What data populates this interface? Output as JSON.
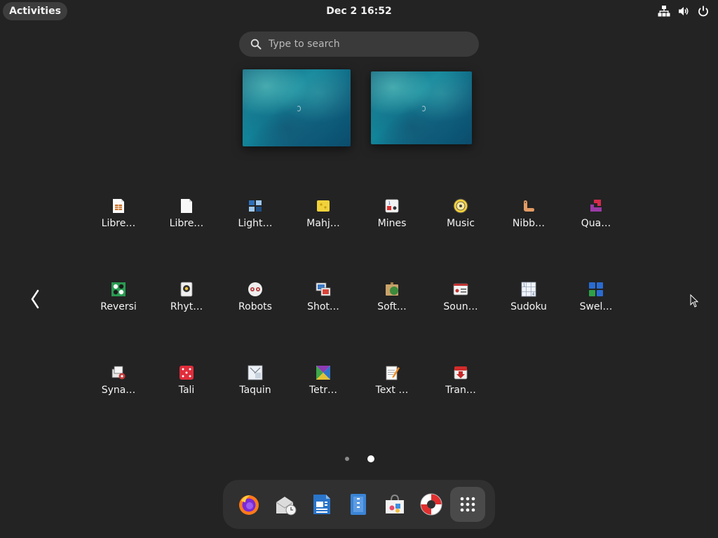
{
  "topbar": {
    "activities_label": "Activities",
    "clock": "Dec 2  16:52",
    "tray_icons": [
      "network-icon",
      "volume-icon",
      "power-icon"
    ]
  },
  "search": {
    "placeholder": "Type to search"
  },
  "workspaces": [
    "workspace-1",
    "workspace-2"
  ],
  "apps": [
    {
      "label": "Libre…",
      "icon": "libreoffice-calc-icon"
    },
    {
      "label": "Libre…",
      "icon": "libreoffice-document-icon"
    },
    {
      "label": "Light…",
      "icon": "lightsoff-icon"
    },
    {
      "label": "Mahj…",
      "icon": "mahjongg-icon"
    },
    {
      "label": "Mines",
      "icon": "mines-icon"
    },
    {
      "label": "Music",
      "icon": "music-icon"
    },
    {
      "label": "Nibb…",
      "icon": "nibbles-icon"
    },
    {
      "label": "Qua…",
      "icon": "quadrapassel-icon"
    },
    {
      "label": "Reversi",
      "icon": "reversi-icon"
    },
    {
      "label": "Rhyt…",
      "icon": "rhythmbox-icon"
    },
    {
      "label": "Robots",
      "icon": "robots-icon"
    },
    {
      "label": "Shot…",
      "icon": "shotwell-icon"
    },
    {
      "label": "Soft…",
      "icon": "software-icon"
    },
    {
      "label": "Soun…",
      "icon": "sound-recorder-icon"
    },
    {
      "label": "Sudoku",
      "icon": "sudoku-icon"
    },
    {
      "label": "Swel…",
      "icon": "swell-foop-icon"
    },
    {
      "label": "Syna…",
      "icon": "synaptic-icon"
    },
    {
      "label": "Tali",
      "icon": "tali-icon"
    },
    {
      "label": "Taquin",
      "icon": "taquin-icon"
    },
    {
      "label": "Tetr…",
      "icon": "tetravex-icon"
    },
    {
      "label": "Text …",
      "icon": "text-editor-icon"
    },
    {
      "label": "Tran…",
      "icon": "transmission-icon"
    }
  ],
  "pagination": {
    "pages": 2,
    "current": 2
  },
  "dash": [
    {
      "name": "firefox-icon"
    },
    {
      "name": "evolution-mail-icon"
    },
    {
      "name": "libreoffice-writer-icon"
    },
    {
      "name": "text-editor-icon"
    },
    {
      "name": "software-center-icon"
    },
    {
      "name": "help-icon"
    },
    {
      "name": "show-apps-icon"
    }
  ],
  "colors": {
    "background": "#232323",
    "activities_bg": "#3d3d3d",
    "search_bg": "#3a3a3a",
    "dash_bg": "#303030"
  }
}
